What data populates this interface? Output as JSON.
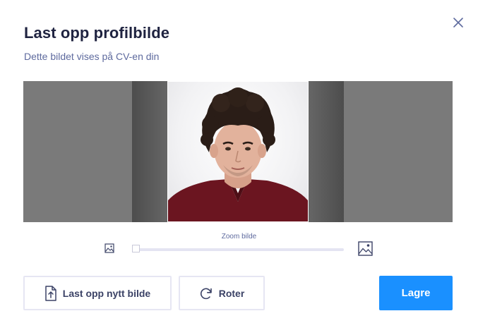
{
  "dialog": {
    "title": "Last opp profilbilde",
    "subtitle": "Dette bildet vises på CV-en din"
  },
  "editor": {
    "zoom_label": "Zoom bilde",
    "zoom_value": 0.0,
    "small_icon": "image-small-icon",
    "large_icon": "image-large-icon"
  },
  "buttons": {
    "upload_label": "Last opp nytt bilde",
    "upload_icon": "file-upload-icon",
    "rotate_label": "Roter",
    "rotate_icon": "rotate-icon",
    "save_label": "Lagre",
    "close_icon": "close-icon"
  },
  "colors": {
    "primary": "#1a90ff",
    "title": "#1f2340",
    "muted": "#5e6a9e"
  }
}
